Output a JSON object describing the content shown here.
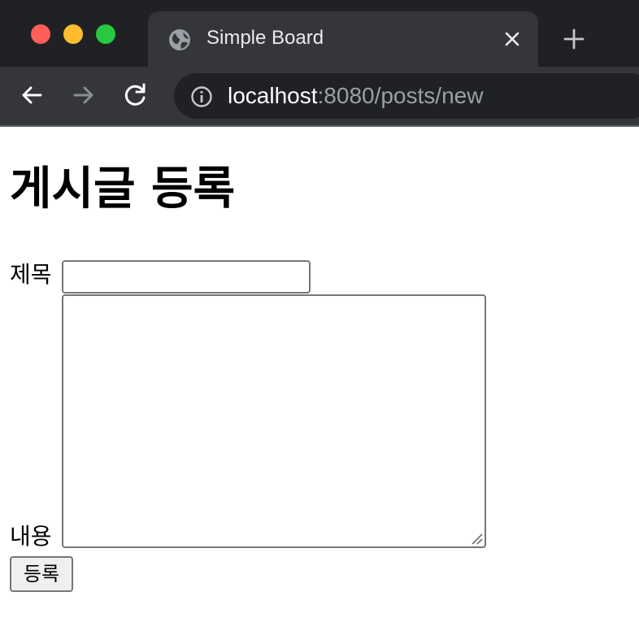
{
  "browser": {
    "tab": {
      "title": "Simple Board",
      "icon": "globe-icon"
    },
    "url": {
      "host": "localhost",
      "rest": ":8080/posts/new"
    },
    "colors": {
      "chrome_dark": "#202124",
      "chrome_tab": "#35363a",
      "red": "#ff5f57",
      "yellow": "#febc2e",
      "green": "#28c840"
    }
  },
  "page": {
    "title": "게시글 등록",
    "form": {
      "title_label": "제목",
      "title_value": "",
      "content_label": "내용",
      "content_value": "",
      "submit_label": "등록"
    }
  }
}
